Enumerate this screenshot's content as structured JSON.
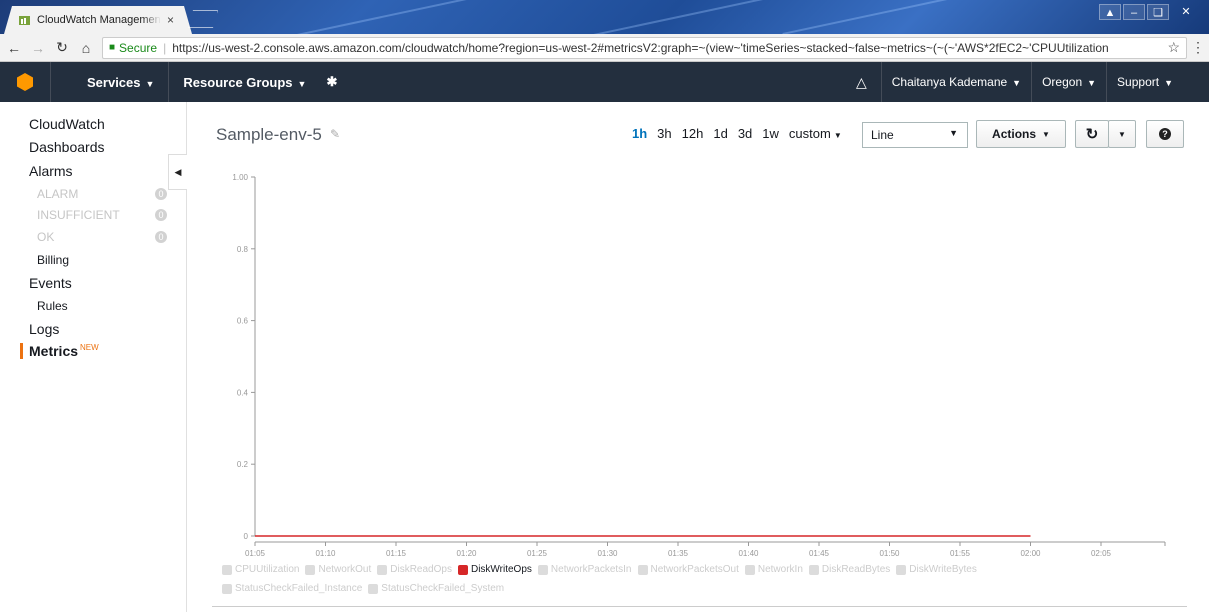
{
  "browser": {
    "tab_title": "CloudWatch Management Console",
    "tab_close": "×",
    "secure_label": "Secure",
    "url": "https://us-west-2.console.aws.amazon.com/cloudwatch/home?region=us-west-2#metricsV2:graph=~(view~'timeSeries~stacked~false~metrics~(~(~'AWS*2fEC2~'CPUUtilization"
  },
  "awsnav": {
    "services": "Services",
    "resource_groups": "Resource Groups",
    "user": "Chaitanya Kademane",
    "region": "Oregon",
    "support": "Support"
  },
  "sidebar": {
    "cloudwatch": "CloudWatch",
    "dashboards": "Dashboards",
    "alarms": "Alarms",
    "alarm_items": [
      {
        "label": "ALARM",
        "count": "0"
      },
      {
        "label": "INSUFFICIENT",
        "count": "0"
      },
      {
        "label": "OK",
        "count": "0"
      }
    ],
    "billing": "Billing",
    "events": "Events",
    "rules": "Rules",
    "logs": "Logs",
    "metrics": "Metrics",
    "metrics_badge": "NEW"
  },
  "graph": {
    "title": "Sample-env-5",
    "time_ranges": [
      "1h",
      "3h",
      "12h",
      "1d",
      "3d",
      "1w",
      "custom"
    ],
    "active_range": "1h",
    "chart_type": "Line",
    "actions_label": "Actions"
  },
  "colors": {
    "accent": "#ec7211",
    "active_series": "#d62728",
    "link": "#0073bb"
  },
  "chart_data": {
    "type": "line",
    "ylim": [
      0,
      1.0
    ],
    "y_ticks": [
      "1.00",
      "0.8",
      "0.6",
      "0.4",
      "0.2",
      "0"
    ],
    "x_ticks": [
      "01:05",
      "01:10",
      "01:15",
      "01:20",
      "01:25",
      "01:30",
      "01:35",
      "01:40",
      "01:45",
      "01:50",
      "01:55",
      "02:00",
      "02:05"
    ],
    "series": [
      {
        "name": "DiskWriteOps",
        "x": [
          "01:05",
          "02:00"
        ],
        "values": [
          0,
          0
        ],
        "visible": true
      }
    ],
    "legend": [
      {
        "name": "CPUUtilization",
        "visible": false
      },
      {
        "name": "NetworkOut",
        "visible": false
      },
      {
        "name": "DiskReadOps",
        "visible": false
      },
      {
        "name": "DiskWriteOps",
        "visible": true
      },
      {
        "name": "NetworkPacketsIn",
        "visible": false
      },
      {
        "name": "NetworkPacketsOut",
        "visible": false
      },
      {
        "name": "NetworkIn",
        "visible": false
      },
      {
        "name": "DiskReadBytes",
        "visible": false
      },
      {
        "name": "DiskWriteBytes",
        "visible": false
      },
      {
        "name": "StatusCheckFailed_Instance",
        "visible": false
      },
      {
        "name": "StatusCheckFailed_System",
        "visible": false
      }
    ]
  }
}
